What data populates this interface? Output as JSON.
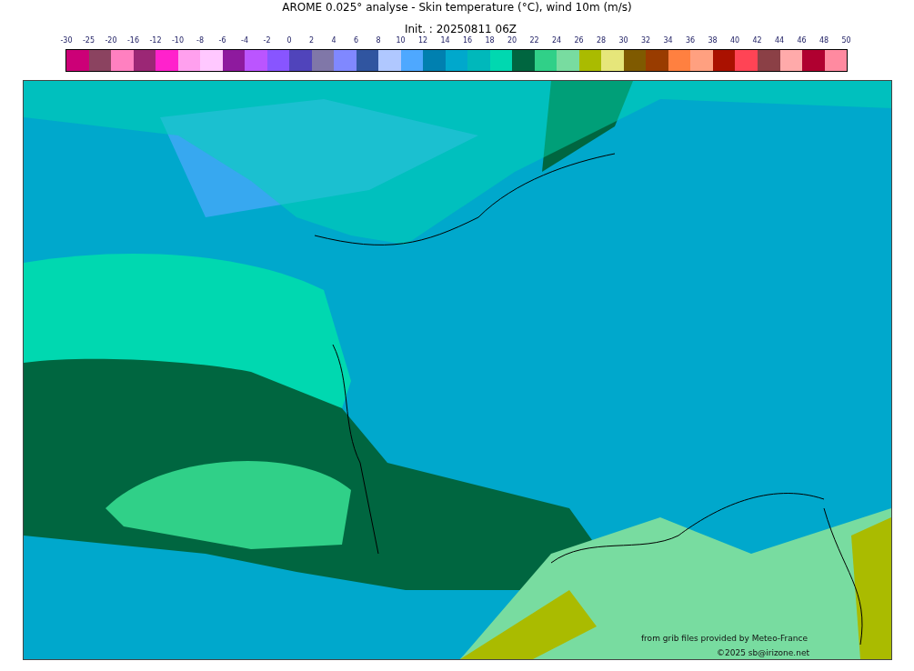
{
  "title": "AROME 0.025° analyse - Skin temperature (°C), wind 10m (m/s)",
  "subtitle": "Init. : 20250811 06Z",
  "colorbar": {
    "ticks": [
      "-30",
      "-25",
      "-20",
      "-16",
      "-12",
      "-10",
      "-8",
      "-6",
      "-4",
      "-2",
      "0",
      "2",
      "4",
      "6",
      "8",
      "10",
      "12",
      "14",
      "16",
      "18",
      "20",
      "22",
      "24",
      "26",
      "28",
      "30",
      "32",
      "34",
      "36",
      "38",
      "40",
      "42",
      "44",
      "46",
      "48",
      "50"
    ],
    "bins": [
      {
        "color": "#cc0077"
      },
      {
        "color": "#8b4360"
      },
      {
        "color": "#ff80c0"
      },
      {
        "color": "#9b2775"
      },
      {
        "color": "#ff22cc"
      },
      {
        "color": "#ffa0ee"
      },
      {
        "color": "#ffc8ff"
      },
      {
        "color": "#8e1a9e"
      },
      {
        "color": "#bb55ff"
      },
      {
        "color": "#8855ff"
      },
      {
        "color": "#5044bb"
      },
      {
        "color": "#8077a8"
      },
      {
        "color": "#8088ff"
      },
      {
        "color": "#3055a0"
      },
      {
        "color": "#b0c8ff"
      },
      {
        "color": "#4ea8ff"
      },
      {
        "color": "#0080b0"
      },
      {
        "color": "#00a8cc"
      },
      {
        "color": "#00b8bb"
      },
      {
        "color": "#00d8b0"
      },
      {
        "color": "#006640"
      },
      {
        "color": "#30d088"
      },
      {
        "color": "#78dca0"
      },
      {
        "color": "#aabb00"
      },
      {
        "color": "#e6e67a"
      },
      {
        "color": "#7f5a00"
      },
      {
        "color": "#993c00"
      },
      {
        "color": "#ff8040"
      },
      {
        "color": "#ffa080"
      },
      {
        "color": "#aa1100"
      },
      {
        "color": "#ff4455"
      },
      {
        "color": "#8b4046"
      },
      {
        "color": "#ffaaaa"
      },
      {
        "color": "#b00030"
      },
      {
        "color": "#ff8aa0"
      }
    ]
  },
  "credits": [
    "from grib files provided by Meteo-France",
    "©2025 sb@irizone.net"
  ]
}
